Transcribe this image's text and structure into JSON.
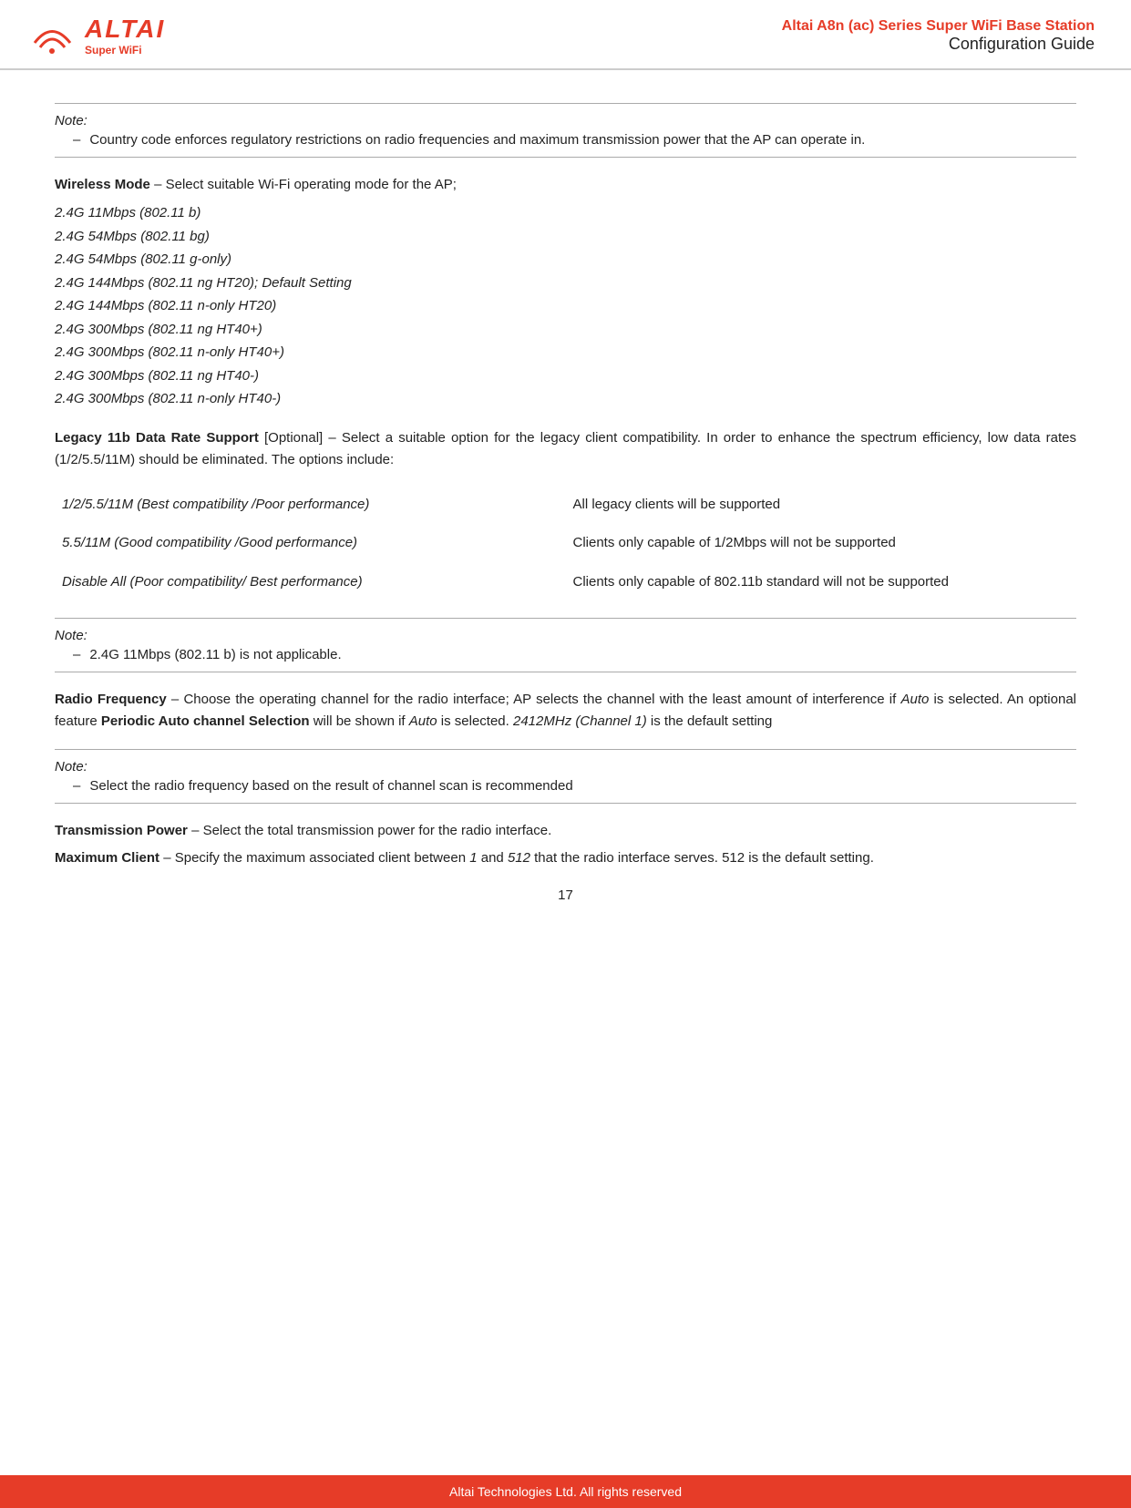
{
  "header": {
    "logo_altai": "ALTAI",
    "logo_sub": "Super WiFi",
    "title": "Altai A8n (ac) Series Super WiFi Base Station",
    "subtitle": "Configuration Guide"
  },
  "note1": {
    "label": "Note:",
    "dash": "–",
    "text": "Country code enforces regulatory restrictions on radio frequencies and maximum transmission power that the AP can operate in."
  },
  "wireless_mode": {
    "label": "Wireless Mode",
    "dash": "–",
    "intro": "Select suitable Wi-Fi operating mode for the AP;",
    "modes": [
      "2.4G 11Mbps (802.11 b)",
      "2.4G 54Mbps (802.11 bg)",
      "2.4G 54Mbps (802.11 g-only)",
      "2.4G 144Mbps (802.11 ng HT20); Default Setting",
      "2.4G 144Mbps (802.11 n-only HT20)",
      "2.4G 300Mbps (802.11 ng HT40+)",
      "2.4G 300Mbps (802.11 n-only HT40+)",
      "2.4G 300Mbps (802.11 ng HT40-)",
      "2.4G 300Mbps (802.11 n-only HT40-)"
    ]
  },
  "legacy": {
    "label": "Legacy 11b Data Rate Support",
    "optional": "[Optional]",
    "dash": "–",
    "intro": "Select a suitable option for the legacy client compatibility. In order to enhance the spectrum efficiency, low data rates (1/2/5.5/11M) should be eliminated. The options include:",
    "rows": [
      {
        "option": "1/2/5.5/11M (Best compatibility /Poor performance)",
        "description": "All legacy clients will be supported"
      },
      {
        "option": "5.5/11M (Good compatibility /Good performance)",
        "description": "Clients only capable of 1/2Mbps will not be supported"
      },
      {
        "option": "Disable All (Poor compatibility/ Best performance)",
        "description": "Clients only capable of 802.11b standard will not be supported"
      }
    ]
  },
  "note2": {
    "label": "Note:",
    "dash": "–",
    "text": "2.4G 11Mbps (802.11 b) is not applicable."
  },
  "radio_frequency": {
    "label": "Radio Frequency",
    "dash": "–",
    "text": "Choose the operating channel for the radio interface; AP selects the channel with the least amount of interference if",
    "auto1": "Auto",
    "text2": "is selected. An optional feature",
    "bold_feature": "Periodic Auto channel Selection",
    "text3": "will be shown if",
    "auto2": "Auto",
    "text4": "is selected.",
    "italic_default": "2412MHz (Channel 1)",
    "text5": "is the default setting"
  },
  "note3": {
    "label": "Note:",
    "dash": "–",
    "text": "Select the radio frequency based on the result of channel scan is recommended"
  },
  "transmission_power": {
    "label": "Transmission Power",
    "dash": "–",
    "text": "Select the total transmission power for the radio interface."
  },
  "maximum_client": {
    "label": "Maximum Client",
    "dash": "–",
    "text": "Specify the maximum associated client between",
    "val1": "1",
    "and": "and",
    "val2": "512",
    "text2": "that the radio interface serves. 512 is the default setting."
  },
  "page_number": "17",
  "footer": "Altai Technologies Ltd. All rights reserved"
}
